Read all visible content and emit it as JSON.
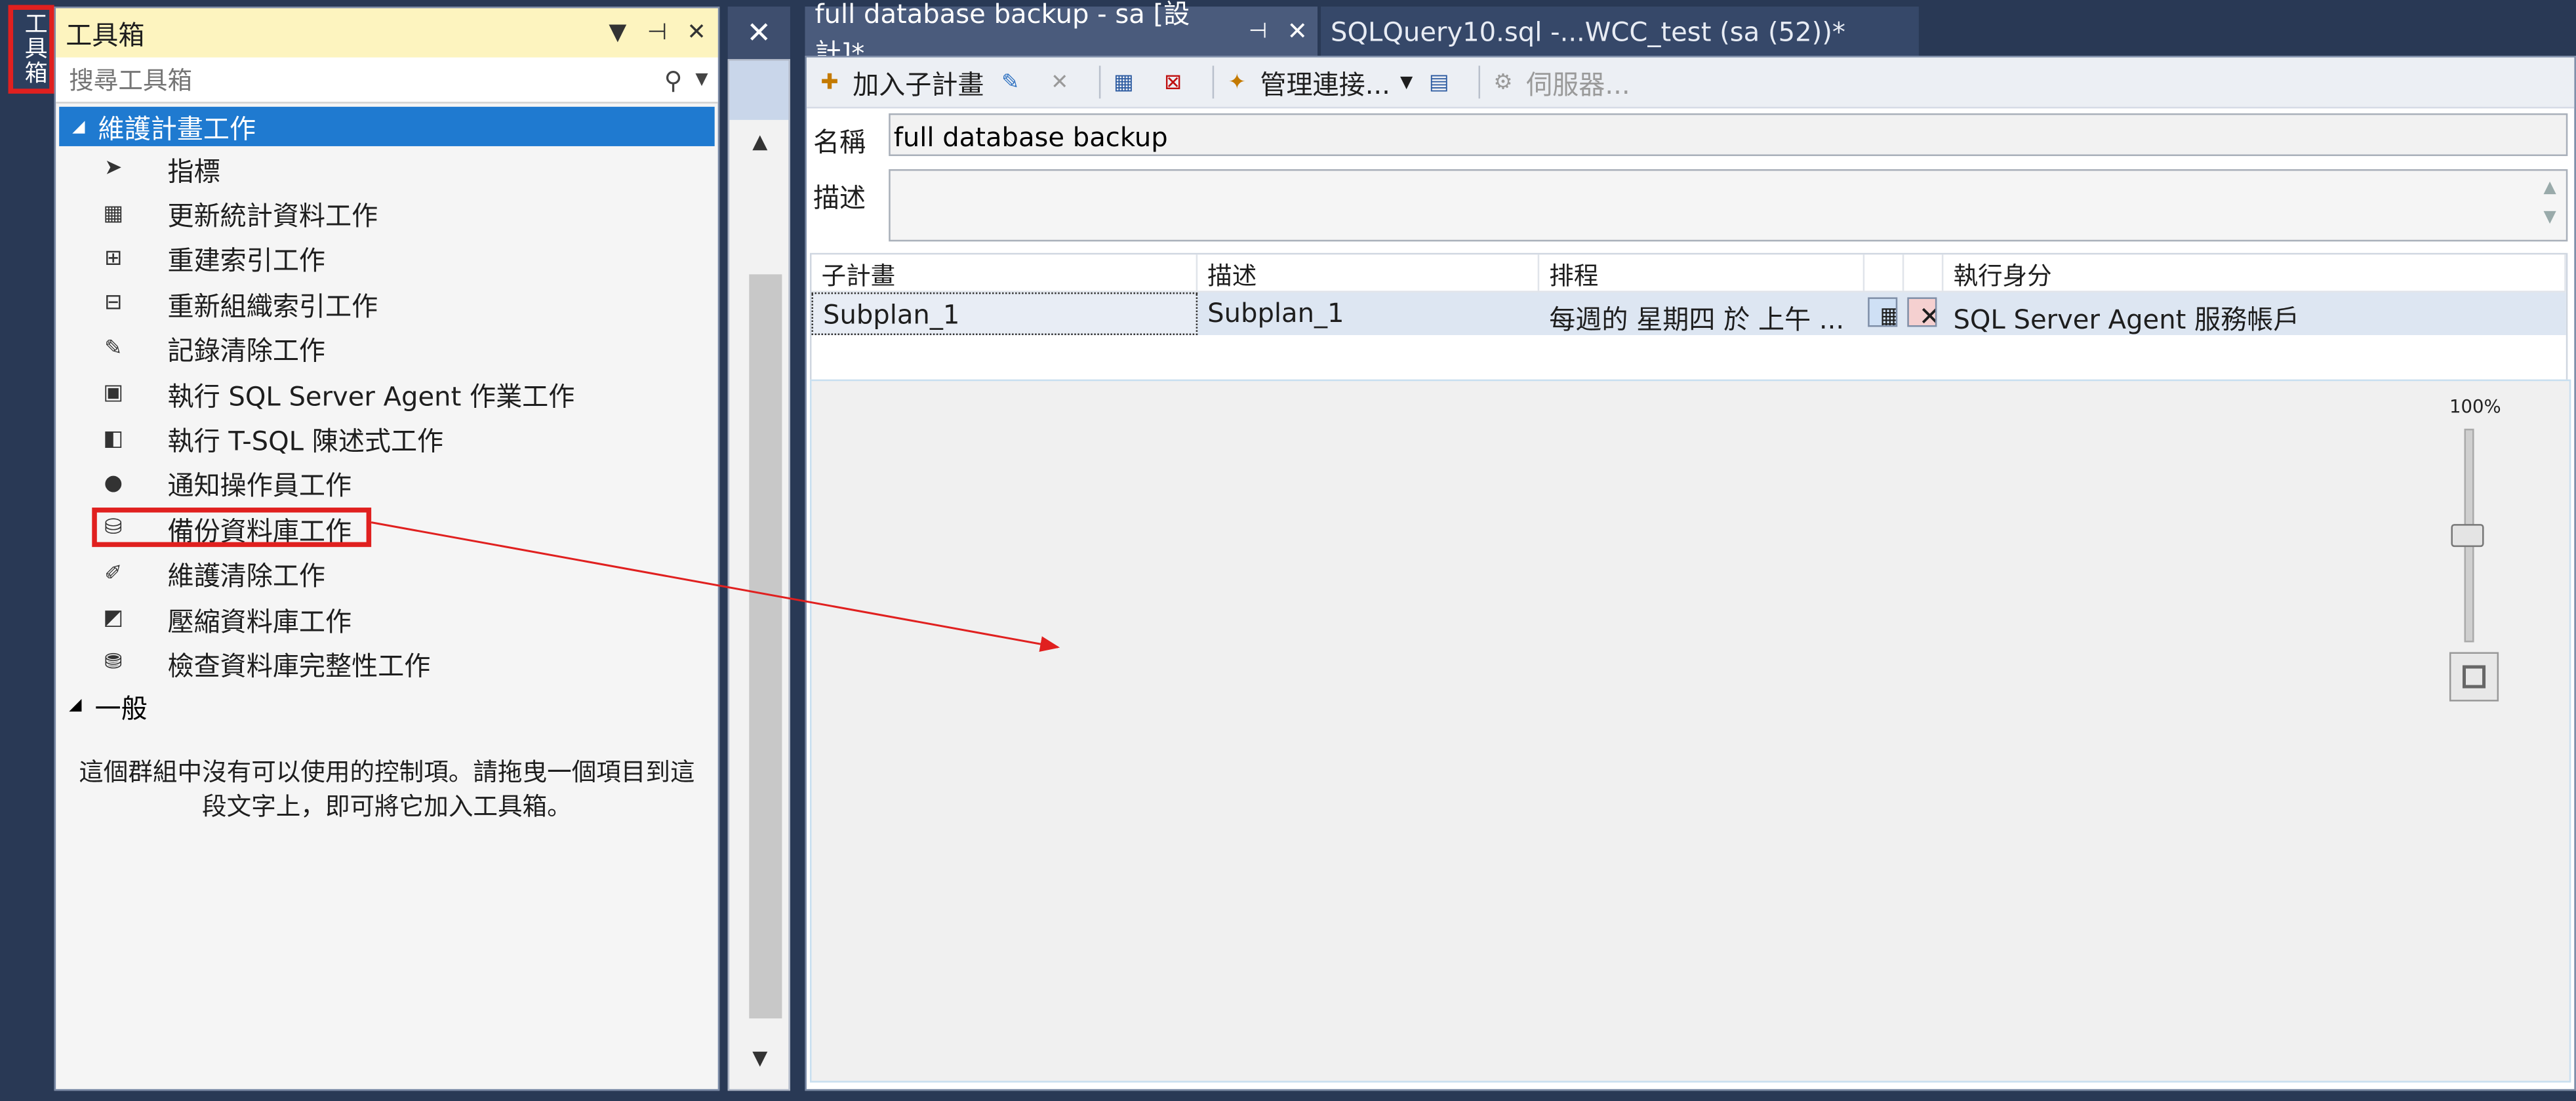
{
  "toolbox_tab": {
    "label": "工具箱"
  },
  "toolbox": {
    "title": "工具箱",
    "search_placeholder": "搜尋工具箱",
    "category_maintenance": "維護計畫工作",
    "items": [
      {
        "label": "指標",
        "icon": "pointer-icon"
      },
      {
        "label": "更新統計資料工作",
        "icon": "update-statistics-icon"
      },
      {
        "label": "重建索引工作",
        "icon": "rebuild-index-icon"
      },
      {
        "label": "重新組織索引工作",
        "icon": "reorganize-index-icon"
      },
      {
        "label": "記錄清除工作",
        "icon": "history-cleanup-icon"
      },
      {
        "label": "執行 SQL Server Agent 作業工作",
        "icon": "agent-job-icon"
      },
      {
        "label": "執行 T-SQL 陳述式工作",
        "icon": "tsql-icon"
      },
      {
        "label": "通知操作員工作",
        "icon": "notify-operator-icon"
      },
      {
        "label": "備份資料庫工作",
        "icon": "backup-database-icon"
      },
      {
        "label": "維護清除工作",
        "icon": "maintenance-cleanup-icon"
      },
      {
        "label": "壓縮資料庫工作",
        "icon": "shrink-database-icon"
      },
      {
        "label": "檢查資料庫完整性工作",
        "icon": "check-integrity-icon"
      }
    ],
    "category_general": "一般",
    "empty_note": "這個群組中沒有可以使用的控制項。請拖曳一個項目到這段文字上，即可將它加入工具箱。"
  },
  "tabs": {
    "active": "full database backup - sa [設計]*",
    "inactive": "SQLQuery10.sql -...WCC_test (sa (52))*"
  },
  "toolbar": {
    "add_subplan": "加入子計畫",
    "manage_connections": "管理連接...",
    "servers": "伺服器..."
  },
  "form": {
    "name_label": "名稱",
    "name_value": "full database backup",
    "desc_label": "描述",
    "desc_value": ""
  },
  "grid": {
    "headers": [
      "子計畫",
      "描述",
      "排程",
      "",
      "",
      "執行身分"
    ],
    "rows": [
      {
        "subplan": "Subplan_1",
        "description": "Subplan_1",
        "schedule": "每週的 星期四 於 上午 ...",
        "run_as": "SQL Server Agent 服務帳戶"
      }
    ]
  },
  "zoom": {
    "label": "100%",
    "value": 100
  },
  "colors": {
    "highlight": "#e0201f",
    "selection": "#1f7ad0",
    "header": "#fdf4bf"
  }
}
